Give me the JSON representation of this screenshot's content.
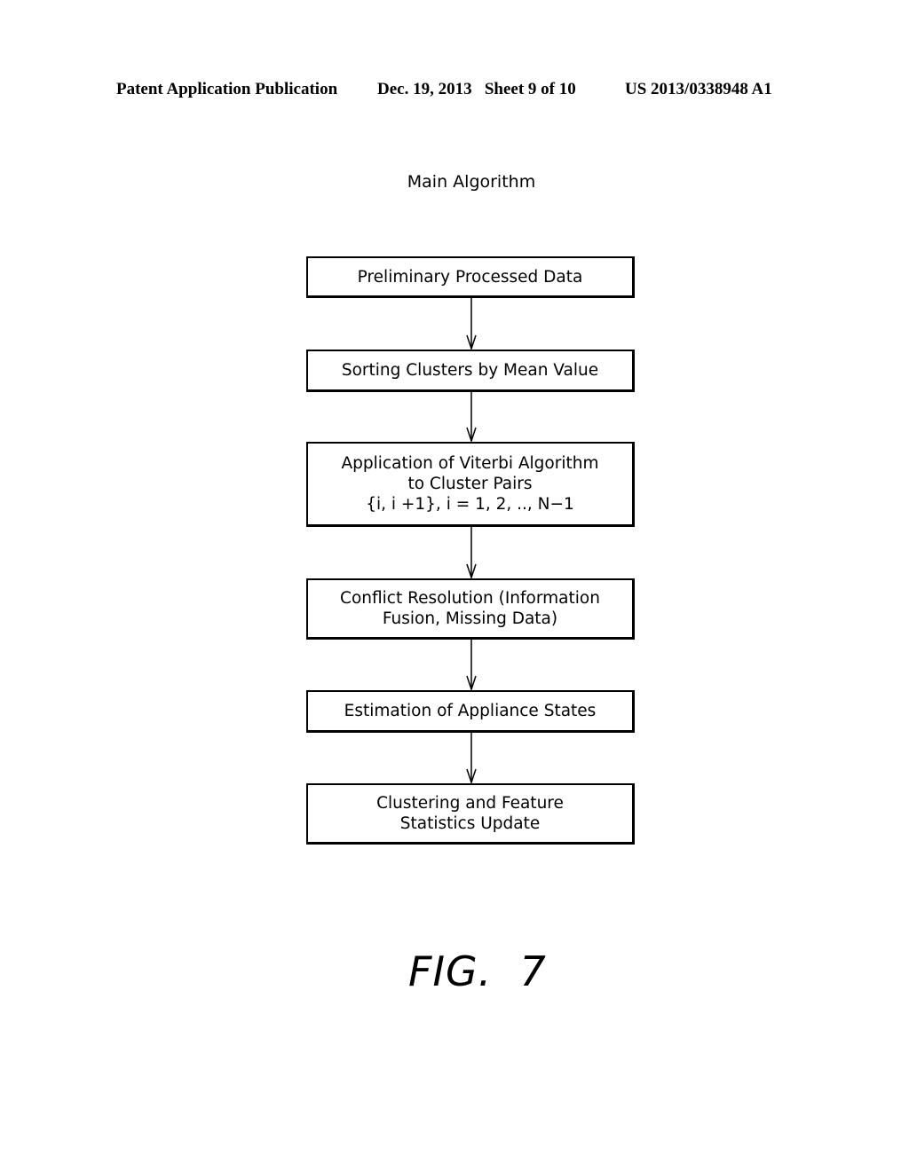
{
  "header": {
    "left": "Patent Application Publication",
    "middle": "Dec. 19, 2013   Sheet 9 of 10",
    "right": "US 2013/0338948 A1"
  },
  "diagram": {
    "title": "Main Algorithm",
    "steps": [
      {
        "label": "Preliminary Processed Data"
      },
      {
        "label": "Sorting Clusters by Mean Value"
      },
      {
        "label": "Application of Viterbi Algorithm\nto Cluster Pairs\n{i, i +1}, i = 1, 2, .., N−1"
      },
      {
        "label": "Conflict Resolution (Information\nFusion, Missing Data)"
      },
      {
        "label": "Estimation of Appliance States"
      },
      {
        "label": "Clustering and Feature\nStatistics Update"
      }
    ],
    "figure_label": "FIG.  7"
  }
}
